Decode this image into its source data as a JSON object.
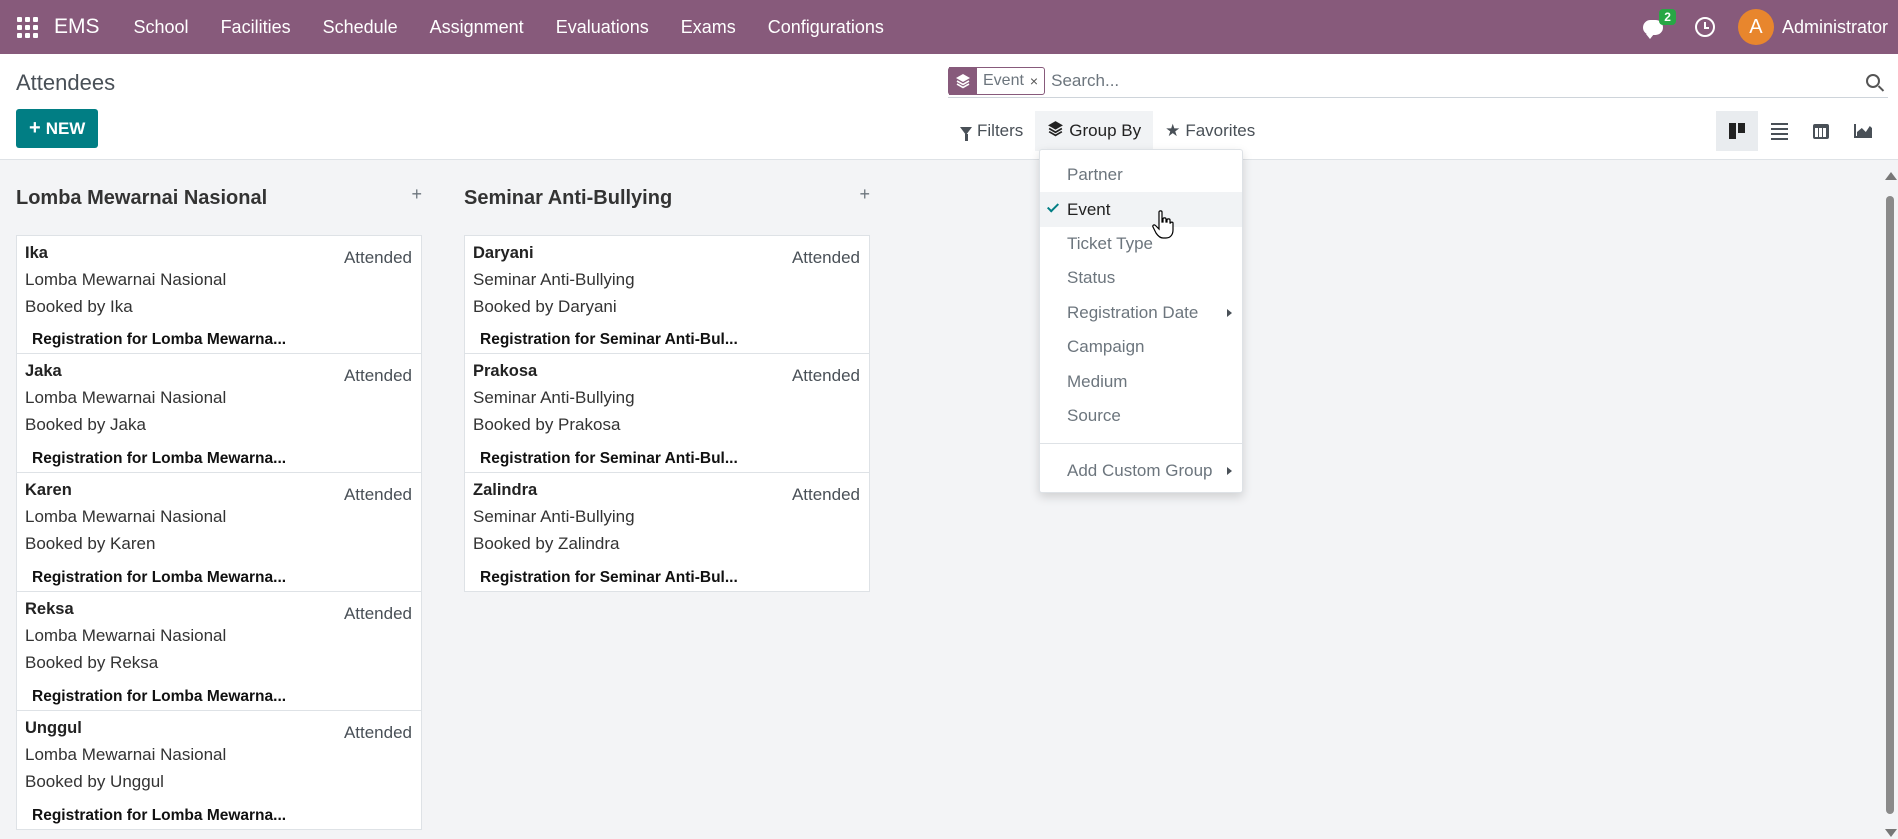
{
  "navbar": {
    "brand": "EMS",
    "menu": [
      "School",
      "Facilities",
      "Schedule",
      "Assignment",
      "Evaluations",
      "Exams",
      "Configurations"
    ],
    "chat_badge": "2",
    "avatar_letter": "A",
    "user_name": "Administrator",
    "color": "#875a7b"
  },
  "control": {
    "title": "Attendees",
    "new_label": "NEW",
    "facet_label": "Event",
    "facet_close": "×",
    "search_placeholder": "Search...",
    "filters_label": "Filters",
    "groupby_label": "Group By",
    "favorites_label": "Favorites"
  },
  "groupby_menu": {
    "items": [
      "Partner",
      "Event",
      "Ticket Type",
      "Status",
      "Registration Date",
      "Campaign",
      "Medium",
      "Source"
    ],
    "selected": "Event",
    "custom": "Add Custom Group"
  },
  "columns": [
    {
      "title": "Lomba Mewarnai Nasional",
      "cards": [
        {
          "name": "Ika",
          "status": "Attended",
          "event": "Lomba Mewarnai Nasional",
          "booked": "Booked by Ika",
          "reg": "Registration for Lomba Mewarna..."
        },
        {
          "name": "Jaka",
          "status": "Attended",
          "event": "Lomba Mewarnai Nasional",
          "booked": "Booked by Jaka",
          "reg": "Registration for Lomba Mewarna..."
        },
        {
          "name": "Karen",
          "status": "Attended",
          "event": "Lomba Mewarnai Nasional",
          "booked": "Booked by Karen",
          "reg": "Registration for Lomba Mewarna..."
        },
        {
          "name": "Reksa",
          "status": "Attended",
          "event": "Lomba Mewarnai Nasional",
          "booked": "Booked by Reksa",
          "reg": "Registration for Lomba Mewarna..."
        },
        {
          "name": "Unggul",
          "status": "Attended",
          "event": "Lomba Mewarnai Nasional",
          "booked": "Booked by Unggul",
          "reg": "Registration for Lomba Mewarna..."
        }
      ]
    },
    {
      "title": "Seminar Anti-Bullying",
      "cards": [
        {
          "name": "Daryani",
          "status": "Attended",
          "event": "Seminar Anti-Bullying",
          "booked": "Booked by Daryani",
          "reg": "Registration for Seminar Anti-Bul..."
        },
        {
          "name": "Prakosa",
          "status": "Attended",
          "event": "Seminar Anti-Bullying",
          "booked": "Booked by Prakosa",
          "reg": "Registration for Seminar Anti-Bul..."
        },
        {
          "name": "Zalindra",
          "status": "Attended",
          "event": "Seminar Anti-Bullying",
          "booked": "Booked by Zalindra",
          "reg": "Registration for Seminar Anti-Bul..."
        }
      ]
    }
  ]
}
